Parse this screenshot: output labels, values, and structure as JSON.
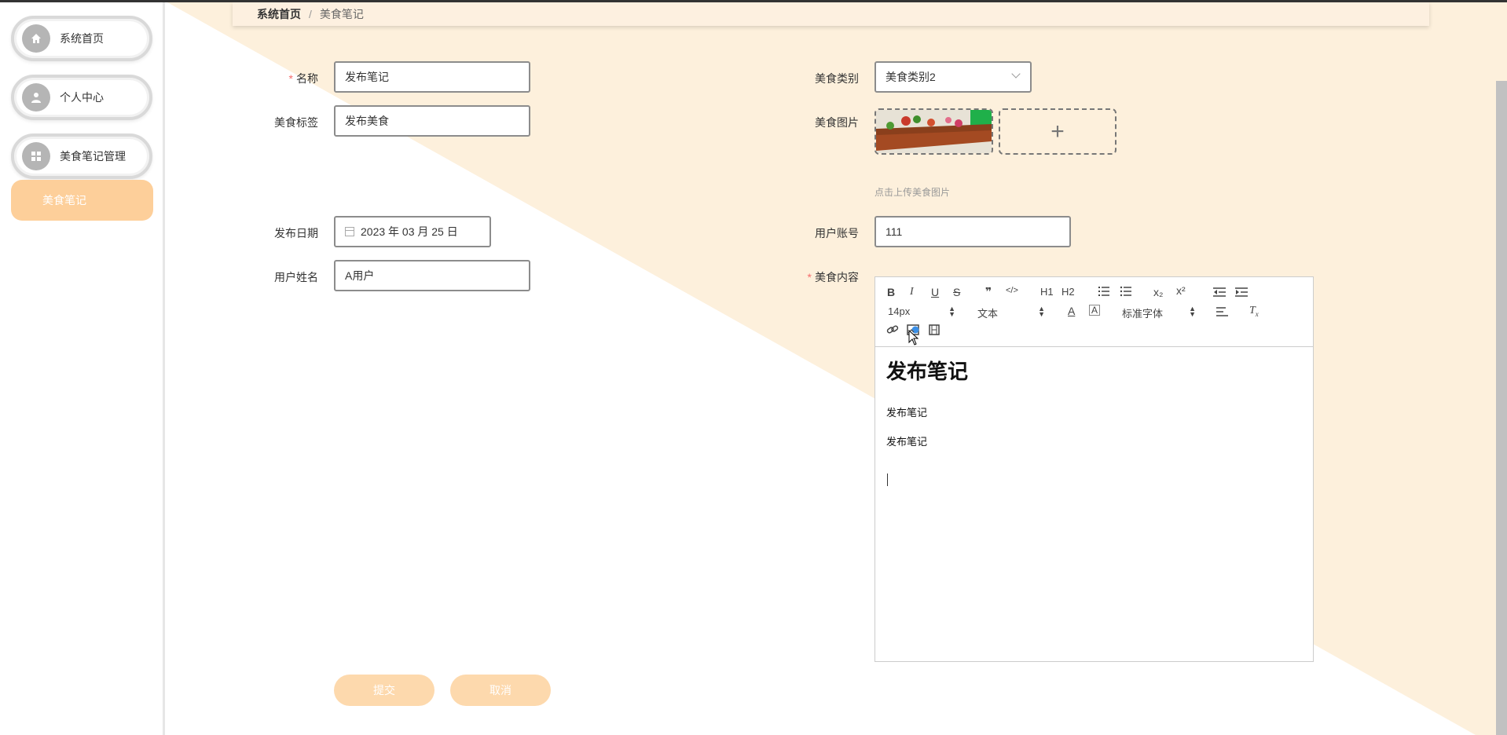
{
  "breadcrumb": {
    "home": "系统首页",
    "separator": "/",
    "current": "美食笔记"
  },
  "sidebar": {
    "items": [
      {
        "label": "系统首页",
        "icon": "home-icon"
      },
      {
        "label": "个人中心",
        "icon": "user-icon"
      },
      {
        "label": "美食笔记管理",
        "icon": "grid-icon"
      }
    ],
    "submenu_active": "美食笔记"
  },
  "form": {
    "name": {
      "label": "名称",
      "value": "发布笔记",
      "required": true
    },
    "tag": {
      "label": "美食标签",
      "value": "发布美食"
    },
    "date": {
      "label": "发布日期",
      "value": "2023 年 03 月 25 日"
    },
    "username": {
      "label": "用户姓名",
      "value": "A用户"
    },
    "category": {
      "label": "美食类别",
      "value": "美食类别2"
    },
    "image": {
      "label": "美食图片",
      "hint": "点击上传美食图片",
      "upload_symbol": "+"
    },
    "account": {
      "label": "用户账号",
      "value": "111"
    },
    "content": {
      "label": "美食内容",
      "required": true
    }
  },
  "editor": {
    "toolbar": {
      "bold": "B",
      "italic": "I",
      "underline": "U",
      "strike": "S",
      "quote": "❞",
      "code": "</>",
      "h1": "H1",
      "h2": "H2",
      "subscript": "x₂",
      "superscript": "x²",
      "size": "14px",
      "header": "文本",
      "font": "标准字体"
    },
    "content": {
      "heading": "发布笔记",
      "paragraphs": [
        "发布笔记",
        "发布笔记"
      ]
    }
  },
  "buttons": {
    "submit": "提交",
    "cancel": "取消"
  },
  "colors": {
    "accent": "#fdcf9a",
    "diagonal": "#fdf0dc",
    "required": "#f56c6c"
  }
}
